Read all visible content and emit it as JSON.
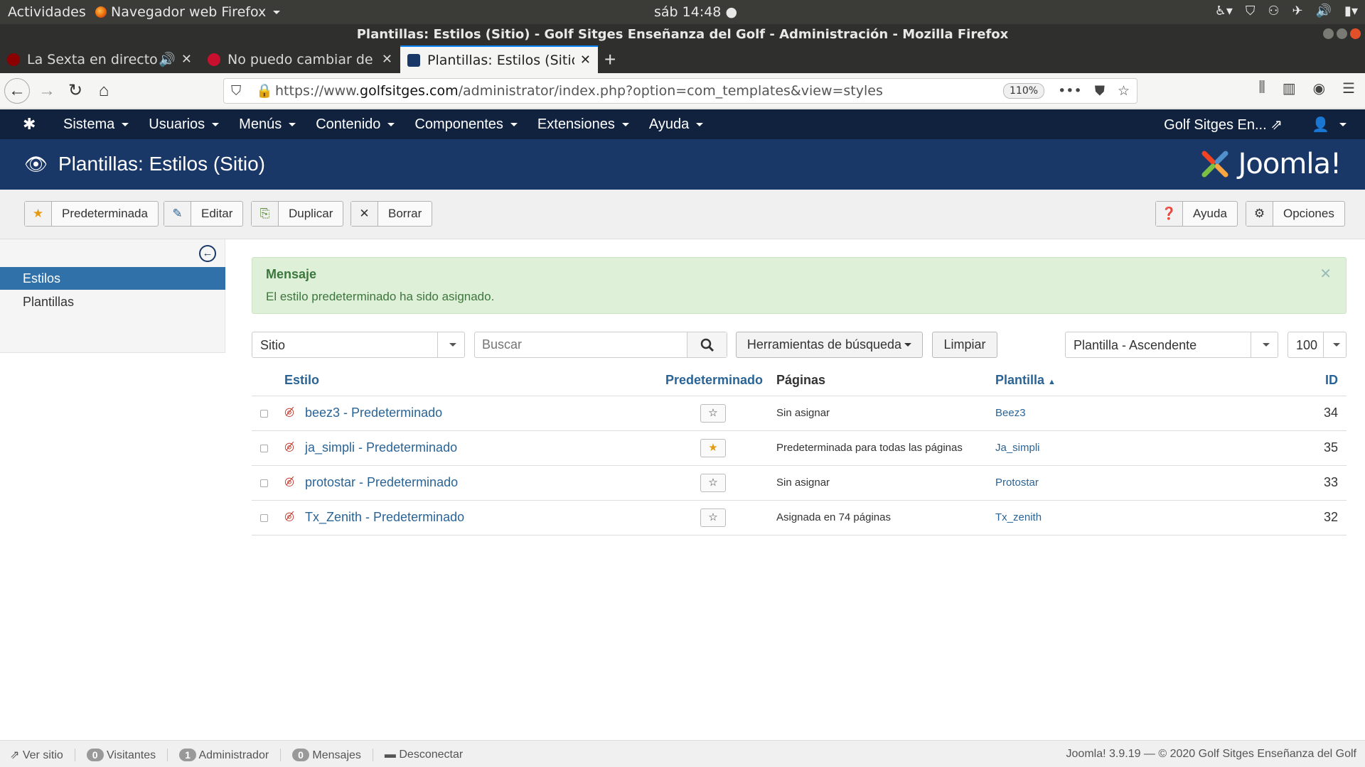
{
  "os": {
    "activities": "Actividades",
    "app_menu": "Navegador web Firefox",
    "clock": "sáb 14:48"
  },
  "window": {
    "title": "Plantillas: Estilos (Sitio) - Golf Sitges Enseñanza del Golf - Administración - Mozilla Firefox"
  },
  "tabs": [
    {
      "label": "La Sexta en directo: Te",
      "favicon_color": "#8b0000"
    },
    {
      "label": "No puedo cambiar de pla",
      "favicon_color": "#c8102e"
    },
    {
      "label": "Plantillas: Estilos (Sitio) - ",
      "favicon_color": "#1a3867"
    }
  ],
  "browser": {
    "url_prefix": "https://www.",
    "url_domain": "golfsitges.com",
    "url_path": "/administrator/index.php?option=com_templates&view=styles",
    "zoom": "110%"
  },
  "joomla": {
    "menu": [
      "Sistema",
      "Usuarios",
      "Menús",
      "Contenido",
      "Componentes",
      "Extensiones",
      "Ayuda"
    ],
    "site_link": "Golf Sitges En...",
    "page_title": "Plantillas: Estilos (Sitio)",
    "brand": "Joomla!",
    "brand_colors": [
      "#f44321",
      "#5091cd",
      "#f9a541",
      "#7ac143"
    ]
  },
  "toolbar": {
    "default": "Predeterminada",
    "edit": "Editar",
    "duplicate": "Duplicar",
    "delete": "Borrar",
    "help": "Ayuda",
    "options": "Opciones"
  },
  "sidebar": {
    "items": [
      {
        "label": "Estilos",
        "active": true
      },
      {
        "label": "Plantillas",
        "active": false
      }
    ]
  },
  "alert": {
    "heading": "Mensaje",
    "text": "El estilo predeterminado ha sido asignado."
  },
  "filters": {
    "client": "Sitio",
    "search_placeholder": "Buscar",
    "search_tools": "Herramientas de búsqueda",
    "clear": "Limpiar",
    "ordering": "Plantilla - Ascendente",
    "limit": "100"
  },
  "table": {
    "headers": {
      "style": "Estilo",
      "default": "Predeterminado",
      "pages": "Páginas",
      "template": "Plantilla",
      "id": "ID"
    },
    "rows": [
      {
        "style": "beez3 - Predeterminado",
        "is_default": false,
        "pages": "Sin asignar",
        "template": "Beez3",
        "id": "34"
      },
      {
        "style": "ja_simpli - Predeterminado",
        "is_default": true,
        "pages": "Predeterminada para todas las páginas",
        "template": "Ja_simpli",
        "id": "35"
      },
      {
        "style": "protostar - Predeterminado",
        "is_default": false,
        "pages": "Sin asignar",
        "template": "Protostar",
        "id": "33"
      },
      {
        "style": "Tx_Zenith - Predeterminado",
        "is_default": false,
        "pages": "Asignada en 74 páginas",
        "template": "Tx_zenith",
        "id": "32"
      }
    ]
  },
  "status": {
    "view_site": "Ver sitio",
    "visitors_count": "0",
    "visitors": "Visitantes",
    "admins_count": "1",
    "admins": "Administrador",
    "messages_count": "0",
    "messages": "Mensajes",
    "logout": "Desconectar",
    "footer": "Joomla! 3.9.19 — © 2020 Golf Sitges Enseñanza del Golf"
  },
  "colors": {
    "nav_dark": "#10223e",
    "title_bar": "#1a3867",
    "active_sidebar": "#3071a9",
    "link": "#2a6496",
    "alert_bg": "#dff0d8",
    "alert_text": "#3c763d",
    "star_active": "#e49b12"
  }
}
